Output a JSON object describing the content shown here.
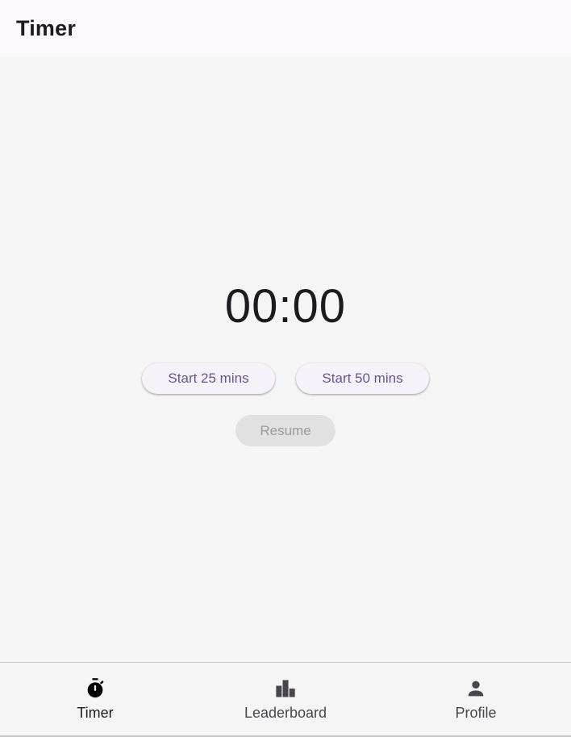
{
  "app_bar": {
    "title": "Timer"
  },
  "timer": {
    "display": "00:00",
    "start_25_label": "Start 25 mins",
    "start_50_label": "Start 50 mins",
    "resume_label": "Resume"
  },
  "bottom_nav": {
    "items": [
      {
        "label": "Timer",
        "icon": "timer-icon",
        "active": true
      },
      {
        "label": "Leaderboard",
        "icon": "leaderboard-icon",
        "active": false
      },
      {
        "label": "Profile",
        "icon": "person-icon",
        "active": false
      }
    ]
  },
  "colors": {
    "app_bar_bg": "#fdf7fe",
    "page_bg": "#f5f5f5",
    "button_text": "#65558f",
    "disabled_bg": "#e1e1e1"
  }
}
